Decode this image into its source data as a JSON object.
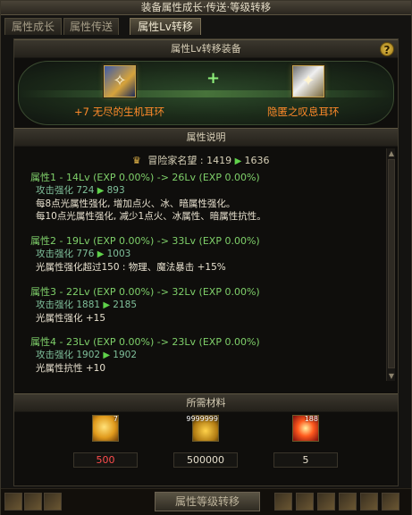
{
  "window": {
    "title": "装备属性成长·传送·等级转移"
  },
  "tabs": [
    {
      "label": "属性成长",
      "active": false
    },
    {
      "label": "属性传送",
      "active": false
    },
    {
      "label": "属性Lv转移",
      "active": true
    }
  ],
  "transfer": {
    "header": "属性Lv转移装备",
    "help_label": "?",
    "plus": "+",
    "source_item": {
      "name": "+7 无尽的生机耳环",
      "icon": "blue-gold-earring-icon"
    },
    "target_item": {
      "name": "隐匿之叹息耳环",
      "icon": "silver-earring-icon"
    }
  },
  "description": {
    "header": "属性说明",
    "fame": {
      "label": "冒险家名望 : 1419",
      "to": "1636"
    },
    "attrs": [
      {
        "title": "属性1 - 14Lv (EXP 0.00%) -> 26Lv (EXP 0.00%)",
        "stat_label": "攻击强化 724",
        "stat_to": "893",
        "lines": [
          "每8点光属性强化, 增加点火、冰、暗属性强化。",
          "每10点光属性强化, 减少1点火、冰属性、暗属性抗性。"
        ]
      },
      {
        "title": "属性2 - 19Lv (EXP 0.00%) -> 33Lv (EXP 0.00%)",
        "stat_label": "攻击强化 776",
        "stat_to": "1003",
        "lines": [
          "光属性强化超过150 : 物理、魔法暴击 +15%"
        ]
      },
      {
        "title": "属性3 - 22Lv (EXP 0.00%) -> 32Lv (EXP 0.00%)",
        "stat_label": "攻击强化 1881",
        "stat_to": "2185",
        "lines": [
          "光属性强化 +15"
        ]
      },
      {
        "title": "属性4 - 23Lv (EXP 0.00%) -> 23Lv (EXP 0.00%)",
        "stat_label": "攻击强化 1902",
        "stat_to": "1902",
        "lines": [
          "光属性抗性 +10"
        ]
      }
    ]
  },
  "materials": {
    "header": "所需材料",
    "items": [
      {
        "icon": "gold-crystal-icon",
        "stack": "7",
        "required": "500",
        "sufficient": false
      },
      {
        "icon": "gold-coins-icon",
        "stack": "9999999",
        "required": "500000",
        "sufficient": true
      },
      {
        "icon": "fire-orb-icon",
        "stack": "188",
        "required": "5",
        "sufficient": true
      }
    ]
  },
  "bottom": {
    "button_label": "属性等级转移"
  },
  "colors": {
    "accent_orange": "#ff8a2a",
    "insufficient_red": "#ff4d4d",
    "attr_green": "#7fd06a"
  }
}
